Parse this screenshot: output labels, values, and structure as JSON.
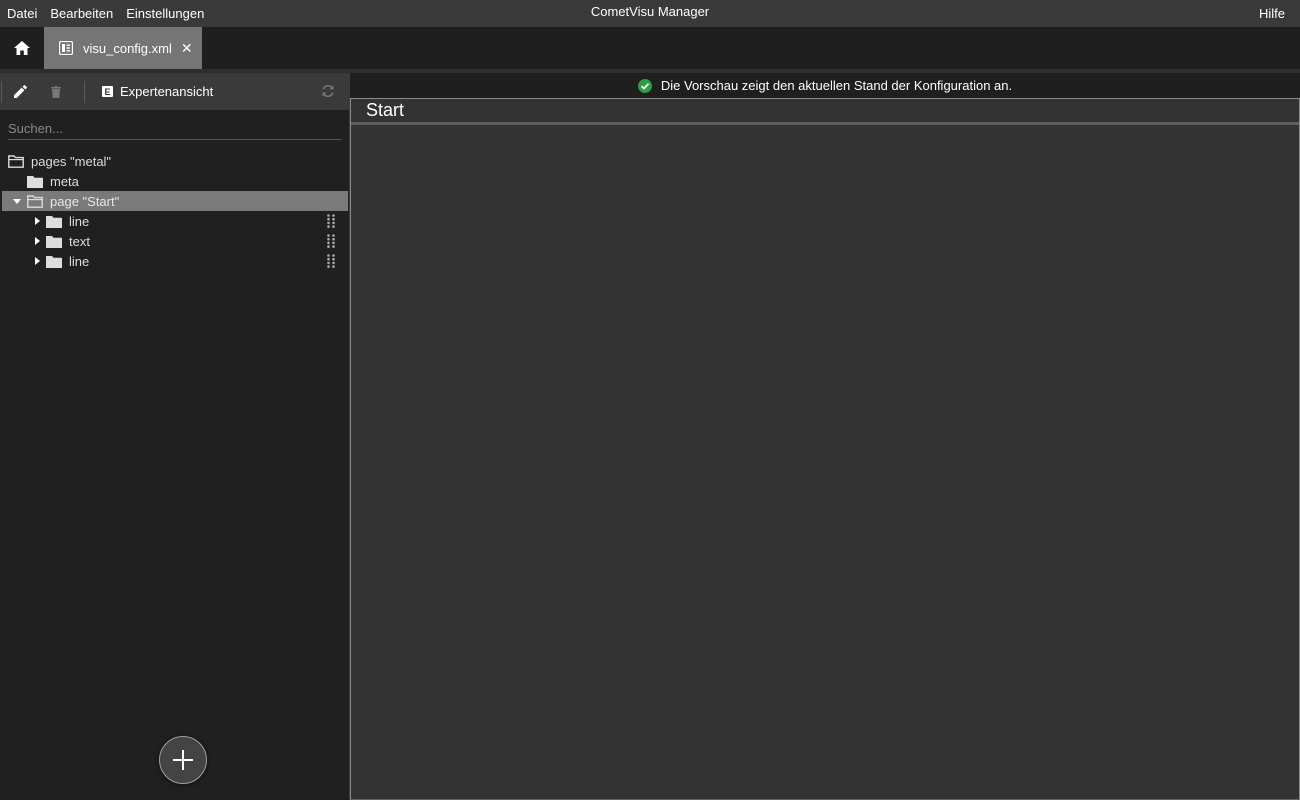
{
  "menubar": {
    "items": [
      "Datei",
      "Bearbeiten",
      "Einstellungen"
    ],
    "title": "CometVisu Manager",
    "help": "Hilfe"
  },
  "tabs": {
    "home_icon": "home-icon",
    "active": {
      "label": "visu_config.xml",
      "icon": "document-icon",
      "close": "✕"
    }
  },
  "toolbar": {
    "edit_icon": "pencil-icon",
    "delete_icon": "trash-icon",
    "expert_label": "Expertenansicht",
    "expert_icon_letter": "E",
    "refresh_icon": "refresh-icon"
  },
  "search": {
    "placeholder": "Suchen...",
    "value": ""
  },
  "tree": {
    "nodes": [
      {
        "label": "pages \"metal\"",
        "level": 0,
        "open": true
      },
      {
        "label": "meta",
        "level": 1
      },
      {
        "label": "page \"Start\"",
        "level": 1,
        "open": true,
        "selected": true
      },
      {
        "label": "line",
        "level": 2
      },
      {
        "label": "text",
        "level": 2
      },
      {
        "label": "line",
        "level": 2
      }
    ]
  },
  "fab": {
    "icon": "plus-icon"
  },
  "preview": {
    "status": "Die Vorschau zeigt den aktuellen Stand der Konfiguration an.",
    "page_title": "Start"
  },
  "colors": {
    "menubar": "#3a3a3a",
    "tab_active": "#757575",
    "selected_node": "#7a7a7a",
    "ok_green": "#2e9e44"
  }
}
